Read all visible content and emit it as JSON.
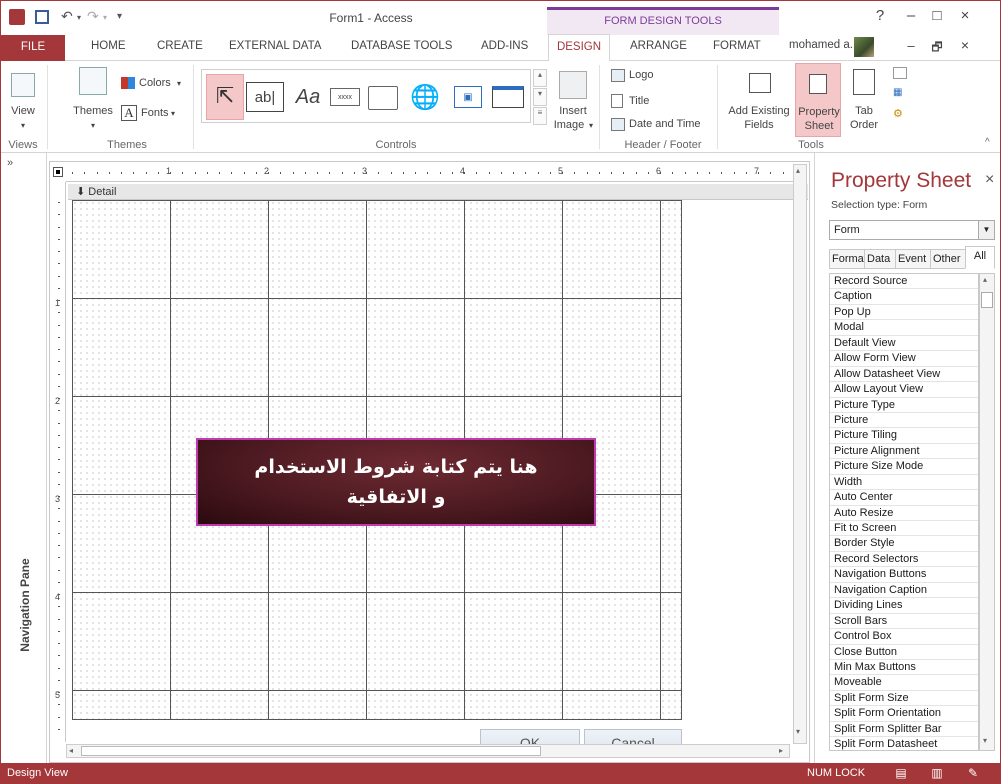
{
  "titlebar": {
    "title": "Form1 - Access",
    "context_tools": "FORM DESIGN TOOLS",
    "help": "?",
    "minimize": "–",
    "restore": "□",
    "close": "×"
  },
  "tabs": {
    "file": "FILE",
    "home": "HOME",
    "create": "CREATE",
    "external_data": "EXTERNAL DATA",
    "database_tools": "DATABASE TOOLS",
    "add_ins": "ADD-INS",
    "design": "DESIGN",
    "arrange": "ARRANGE",
    "format": "FORMAT",
    "user": "mohamed a...",
    "doc_minimize": "–",
    "doc_restore": "🗗",
    "doc_close": "×"
  },
  "ribbon": {
    "views": {
      "view": "View",
      "group": "Views"
    },
    "themes": {
      "themes": "Themes",
      "colors": "Colors",
      "fonts": "Fonts",
      "group": "Themes"
    },
    "controls": {
      "textbox": "ab|",
      "label": "Aa",
      "button": "xxxx",
      "group": "Controls",
      "insert_image_1": "Insert",
      "insert_image_2": "Image"
    },
    "header_footer": {
      "logo": "Logo",
      "title": "Title",
      "date_time": "Date and Time",
      "group": "Header / Footer"
    },
    "tools": {
      "add_existing_1": "Add Existing",
      "add_existing_2": "Fields",
      "property_1": "Property",
      "property_2": "Sheet",
      "tab_1": "Tab",
      "tab_2": "Order",
      "group": "Tools"
    }
  },
  "nav_pane": {
    "label": "Navigation Pane",
    "collapse": "»"
  },
  "design": {
    "detail": "Detail",
    "ruler_h": [
      "1",
      "2",
      "3",
      "4",
      "5",
      "6",
      "7"
    ],
    "ruler_v": [
      "1",
      "2",
      "3",
      "4",
      "5"
    ],
    "arabic_line1": "هنا يتم كتابة شروط الاستخدام",
    "arabic_line2": "و الاتفاقية",
    "ok": "OK",
    "cancel": "Cancel"
  },
  "property_sheet": {
    "title": "Property Sheet",
    "close": "×",
    "selection_type": "Selection type:  Form",
    "selected": "Form",
    "tabs": [
      "Format",
      "Data",
      "Event",
      "Other",
      "All"
    ],
    "active_tab": "All",
    "properties": [
      "Record Source",
      "Caption",
      "Pop Up",
      "Modal",
      "Default View",
      "Allow Form View",
      "Allow Datasheet View",
      "Allow Layout View",
      "Picture Type",
      "Picture",
      "Picture Tiling",
      "Picture Alignment",
      "Picture Size Mode",
      "Width",
      "Auto Center",
      "Auto Resize",
      "Fit to Screen",
      "Border Style",
      "Record Selectors",
      "Navigation Buttons",
      "Navigation Caption",
      "Dividing Lines",
      "Scroll Bars",
      "Control Box",
      "Close Button",
      "Min Max Buttons",
      "Moveable",
      "Split Form Size",
      "Split Form Orientation",
      "Split Form Splitter Bar",
      "Split Form Datasheet"
    ]
  },
  "statusbar": {
    "left": "Design View",
    "num_lock": "NUM LOCK"
  },
  "colors": {
    "accent": "#a4373a",
    "context": "#7d3c98",
    "form_box": "#4d1a21"
  }
}
